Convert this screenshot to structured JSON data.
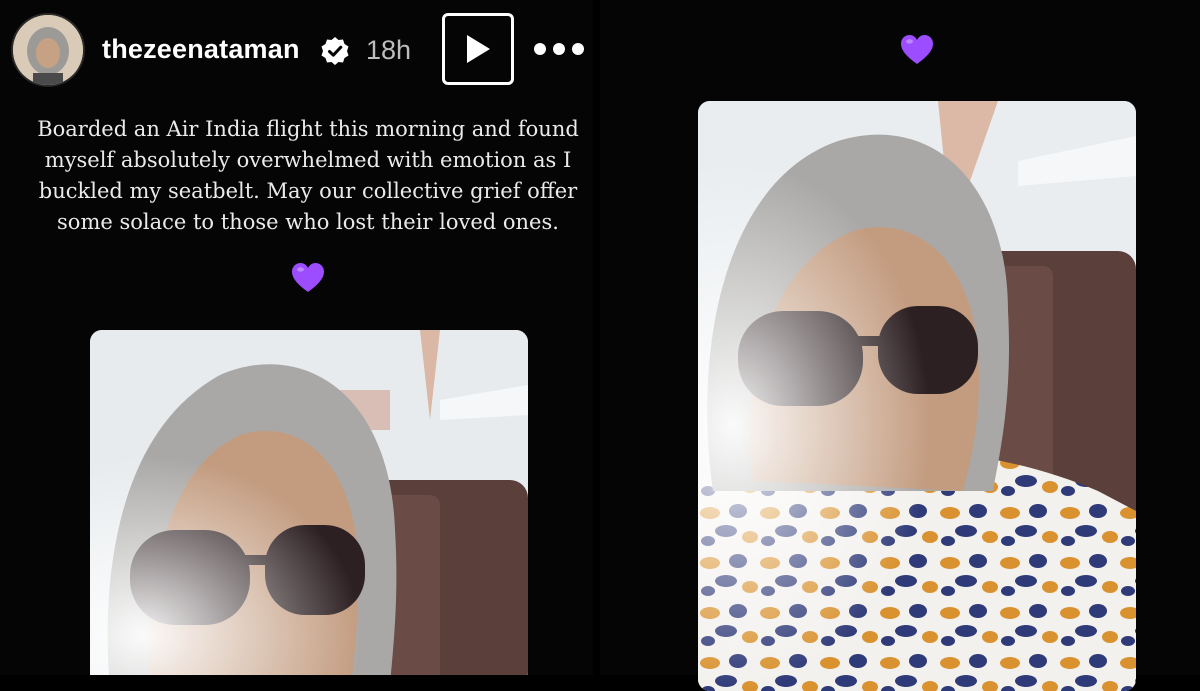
{
  "post": {
    "username": "thezeenataman",
    "time": "18h",
    "caption": "Boarded an Air India flight this morning and found myself absolutely overwhelmed with emotion as I buckled my seatbelt. May our collective grief offer some solace to those who lost their loved ones.",
    "heart_emoji": "purple-heart-icon"
  },
  "icons": {
    "verified": "verified-badge-icon",
    "play": "play-icon",
    "more": "more-options-icon"
  },
  "colors": {
    "background": "#050505",
    "text": "#ffffff",
    "time": "#bdbdbd",
    "heart": "#9b4dff"
  }
}
